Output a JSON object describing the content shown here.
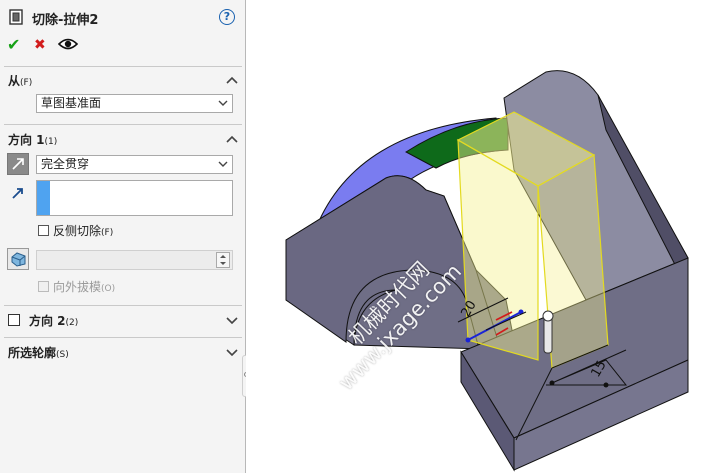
{
  "panel": {
    "title": "切除-拉伸2",
    "help_label": "?",
    "actions": {
      "ok": "✔",
      "cancel": "✖",
      "preview": "👁"
    },
    "from": {
      "title": "从",
      "shortcut": "(F)",
      "value": "草图基准面"
    },
    "direction1": {
      "title": "方向 1",
      "shortcut": "(1)",
      "end_condition": "完全贯穿",
      "direction_value": "",
      "flip_side": "反侧切除",
      "flip_side_shortcut": "(F)",
      "draft_value": "",
      "draft_outward": "向外拔模",
      "draft_outward_shortcut": "(O)"
    },
    "direction2": {
      "title": "方向 2",
      "shortcut": "(2)"
    },
    "selected_contours": {
      "title": "所选轮廓",
      "shortcut": "(S)"
    }
  },
  "viewport": {
    "dim_20": "20",
    "dim_15": "15",
    "watermark_line1": "机械时代网",
    "watermark_line2": "www.jxage.com"
  },
  "colors": {
    "part_face": "#6f6e86",
    "part_top": "#8c8ca2",
    "part_dark": "#504e66",
    "preview_yellow": "#f4f190",
    "sketch_blue": "#1a24d6",
    "arc_blue": "#7a7cf0",
    "arc_green": "#0e6a1a"
  }
}
